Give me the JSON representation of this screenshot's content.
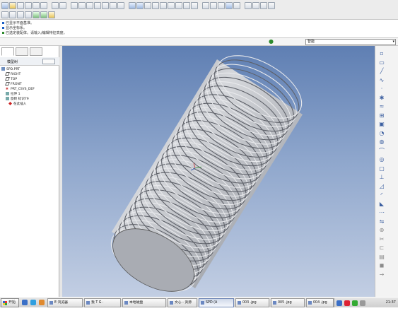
{
  "app": {
    "message_lines": [
      "已显示平面基准。",
      "显示坐标系。",
      "已选定装配体。请输入/编辑特征高度。"
    ],
    "filter": {
      "value": "智能",
      "options": [
        "智能"
      ]
    }
  },
  "model_tree": {
    "header_label": "模型树",
    "items": [
      {
        "icon": "part-icon",
        "label": "SPD.PRT"
      },
      {
        "icon": "datum-plane-icon",
        "label": "RIGHT"
      },
      {
        "icon": "datum-plane-icon",
        "label": "TOP"
      },
      {
        "icon": "datum-plane-icon",
        "label": "FRONT"
      },
      {
        "icon": "csys-icon",
        "label": "PRT_CSYS_DEF"
      },
      {
        "icon": "feature-icon",
        "label": "拉伸 1"
      },
      {
        "icon": "feature-icon",
        "label": "旋转 标识79"
      },
      {
        "icon": "insert-here-icon",
        "label": "在此插入"
      }
    ]
  },
  "taskbar": {
    "start_label": "开始",
    "buttons": [
      {
        "label": "E 浏览器",
        "active": false
      },
      {
        "label": "我 T G ·",
        "active": false
      },
      {
        "label": "本地磁盘",
        "active": false
      },
      {
        "label": "文心 - 资源",
        "active": false
      },
      {
        "label": "SPD (A",
        "active": true
      },
      {
        "label": "003 .jpg",
        "active": false
      },
      {
        "label": "005 .jpg",
        "active": false
      },
      {
        "label": "004 .jpg",
        "active": false
      }
    ],
    "clock": "21:37"
  },
  "colors": {
    "accent": "#1b5fc6",
    "viewport_top": "#5f7fb3",
    "viewport_bottom": "#c2cee3",
    "model_body": "#b9bcc2"
  }
}
